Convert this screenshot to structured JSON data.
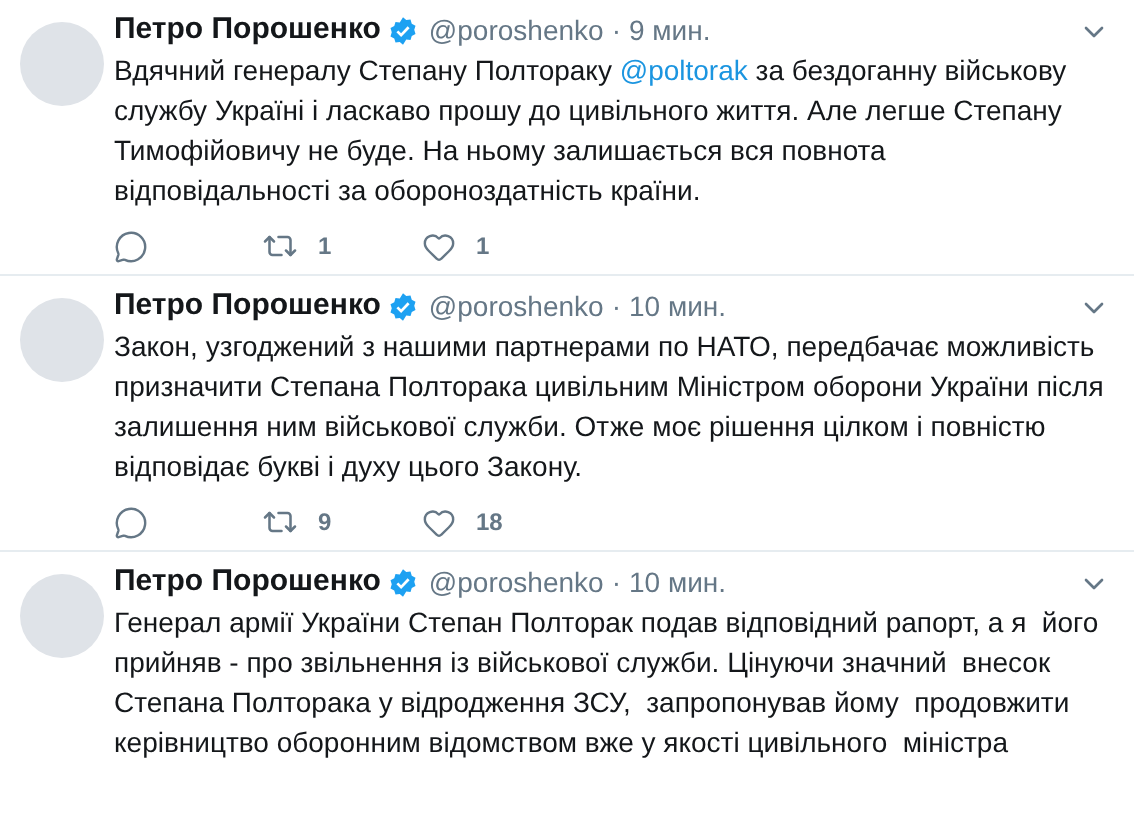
{
  "tweets": [
    {
      "name": "Петро Порошенко",
      "verified": true,
      "handle": "@poroshenko",
      "separator": "·",
      "time": "9 мин.",
      "body": [
        {
          "kind": "text",
          "text": "Вдячний генералу Степану Полтораку "
        },
        {
          "kind": "mention",
          "text": "@poltorak"
        },
        {
          "kind": "text",
          "text": " за бездоганну військову службу Україні і ласкаво прошу до цивільного життя. Але легше Степану Тимофійовичу не буде. На ньому залишається вся повнота відповідальності за обороноздатність країни."
        }
      ],
      "actions": {
        "retweets": "1",
        "likes": "1"
      }
    },
    {
      "name": "Петро Порошенко",
      "verified": true,
      "handle": "@poroshenko",
      "separator": "·",
      "time": "10 мин.",
      "body": [
        {
          "kind": "text",
          "text": "Закон, узгоджений з нашими партнерами по НАТО, передбачає можливість призначити Степана Полторака цивільним Міністром оборони України після залишення ним військової служби. Отже моє рішення цілком і повністю відповідає букві і духу цього Закону."
        }
      ],
      "actions": {
        "retweets": "9",
        "likes": "18"
      }
    },
    {
      "name": "Петро Порошенко",
      "verified": true,
      "handle": "@poroshenko",
      "separator": "·",
      "time": "10 мин.",
      "body": [
        {
          "kind": "text",
          "text": "Генерал армії України Степан Полторак подав відповідний рапорт, а я  його прийняв - про звільнення із військової служби. Цінуючи значний  внесок Степана Полторака у відродження ЗСУ,  запропонував йому  продовжити керівництво оборонним відомством вже у якості цивільного  міністра"
        }
      ]
    }
  ]
}
